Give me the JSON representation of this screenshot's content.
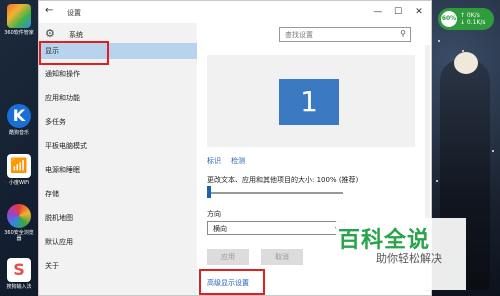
{
  "desktop": {
    "icons": [
      {
        "label": "360软件管家",
        "color": "#e85b35"
      },
      {
        "label": "酷狗音乐",
        "color": "#1a6fd6"
      },
      {
        "label": "小度WiFi",
        "color": "#1c8ee0"
      },
      {
        "label": "360安全浏览器",
        "color": "#39a540"
      },
      {
        "label": "搜狗输入法",
        "color": "#e64d4d"
      }
    ],
    "gauge": {
      "percent": "60%",
      "line1": "↑ 0K/s",
      "line2": "↓ 0.1K/s"
    },
    "watermark": {
      "title": "百科全说",
      "subtitle": "助你轻松解决"
    }
  },
  "window": {
    "title": "设置",
    "back": "←",
    "controls": {
      "minimize": "—",
      "maximize": "☐",
      "close": "✕"
    }
  },
  "sidebar": {
    "header": "系统",
    "items": [
      {
        "label": "显示",
        "active": true
      },
      {
        "label": "通知和操作",
        "active": false
      },
      {
        "label": "应用和功能",
        "active": false
      },
      {
        "label": "多任务",
        "active": false
      },
      {
        "label": "平板电脑模式",
        "active": false
      },
      {
        "label": "电源和睡眠",
        "active": false
      },
      {
        "label": "存储",
        "active": false
      },
      {
        "label": "脱机地图",
        "active": false
      },
      {
        "label": "默认应用",
        "active": false
      },
      {
        "label": "关于",
        "active": false
      }
    ]
  },
  "search": {
    "placeholder": "查找设置"
  },
  "content": {
    "monitor_number": "1",
    "identify_link": "标识",
    "detect_link": "检测",
    "scale_label": "更改文本、应用和其他项目的大小: 100% (推荐)",
    "scale_value_percent": 0,
    "orientation_label": "方向",
    "orientation_value": "横向",
    "apply_button": "应用",
    "cancel_button": "取消",
    "advanced_link": "高级显示设置"
  },
  "colors": {
    "accent": "#1c62b9",
    "monitor": "#3b79c2",
    "highlight": "#b8d3ee",
    "annotation": "#e02020"
  }
}
